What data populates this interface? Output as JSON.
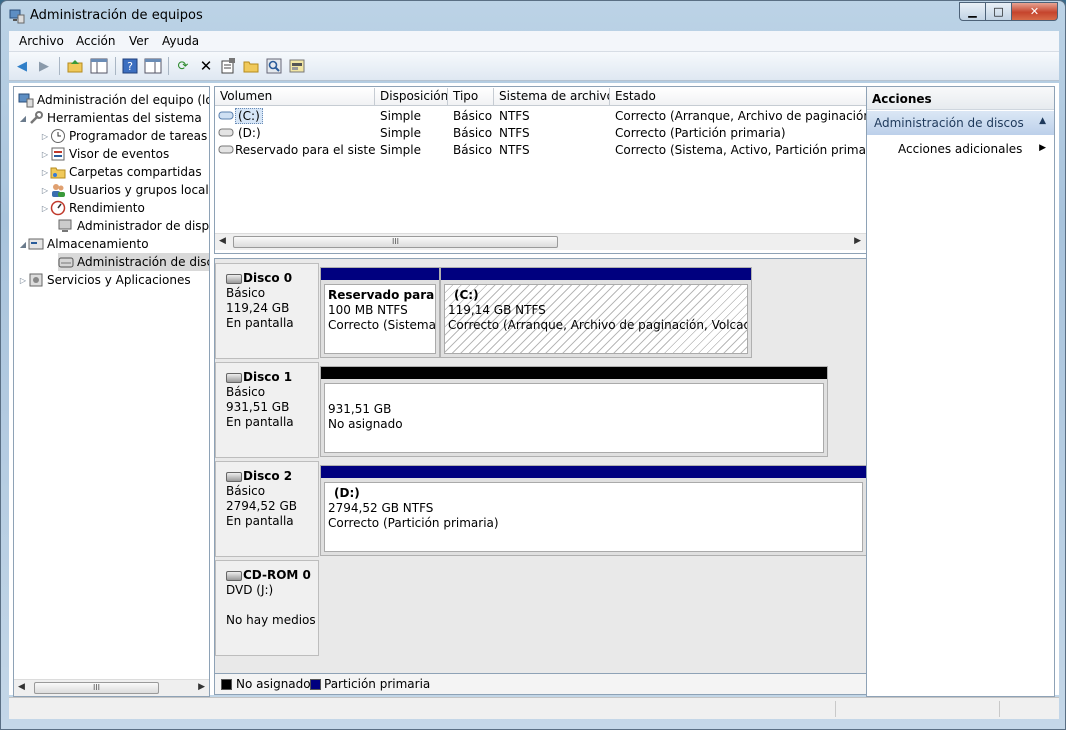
{
  "window": {
    "title": "Administración de equipos",
    "buttons": {
      "minimize": "▁",
      "maximize": "□",
      "close": "✕"
    }
  },
  "menu": [
    "Archivo",
    "Acción",
    "Ver",
    "Ayuda"
  ],
  "tree": {
    "items": [
      {
        "label": "Administración del equipo (loc",
        "icon": "computer-management-icon"
      },
      {
        "label": "Herramientas del sistema",
        "icon": "tools-icon"
      },
      {
        "label": "Programador de tareas",
        "icon": "clock-icon"
      },
      {
        "label": "Visor de eventos",
        "icon": "event-viewer-icon"
      },
      {
        "label": "Carpetas compartidas",
        "icon": "shared-folder-icon"
      },
      {
        "label": "Usuarios y grupos locale",
        "icon": "users-icon"
      },
      {
        "label": "Rendimiento",
        "icon": "performance-icon"
      },
      {
        "label": "Administrador de dispo",
        "icon": "device-manager-icon"
      },
      {
        "label": "Almacenamiento",
        "icon": "storage-icon"
      },
      {
        "label": "Administración de disco",
        "icon": "disk-management-icon"
      },
      {
        "label": "Servicios y Aplicaciones",
        "icon": "services-icon"
      }
    ],
    "scroll_thumb": "III"
  },
  "volumes": {
    "headers": [
      "Volumen",
      "Disposición",
      "Tipo",
      "Sistema de archivos",
      "Estado"
    ],
    "rows": [
      {
        "name": "(C:)",
        "layout": "Simple",
        "type": "Básico",
        "fs": "NTFS",
        "status": "Correcto (Arranque, Archivo de paginación, Vol"
      },
      {
        "name": "(D:)",
        "layout": "Simple",
        "type": "Básico",
        "fs": "NTFS",
        "status": "Correcto (Partición primaria)"
      },
      {
        "name": "Reservado para el sistema",
        "layout": "Simple",
        "type": "Básico",
        "fs": "NTFS",
        "status": "Correcto (Sistema, Activo, Partición primaria)"
      }
    ],
    "scroll_thumb": "III"
  },
  "disks": [
    {
      "name": "Disco 0",
      "kind": "Básico",
      "size": "119,24 GB",
      "state": "En pantalla",
      "parts": [
        {
          "title": "Reservado para el s",
          "size": "100 MB NTFS",
          "status": "Correcto (Sistema, A"
        },
        {
          "title": "(C:)",
          "size": "119,14 GB NTFS",
          "status": "Correcto (Arranque, Archivo de paginación, Volcado, Pa"
        }
      ]
    },
    {
      "name": "Disco 1",
      "kind": "Básico",
      "size": "931,51 GB",
      "state": "En pantalla",
      "parts": [
        {
          "size": "931,51 GB",
          "status": "No asignado"
        }
      ]
    },
    {
      "name": "Disco 2",
      "kind": "Básico",
      "size": "2794,52 GB",
      "state": "En pantalla",
      "parts": [
        {
          "title": "(D:)",
          "size": "2794,52 GB NTFS",
          "status": "Correcto (Partición primaria)"
        }
      ]
    },
    {
      "name": "CD-ROM 0",
      "kind": "DVD (J:)",
      "state": "No hay medios"
    }
  ],
  "legend": {
    "unallocated": "No asignado",
    "primary": "Partición primaria"
  },
  "actions": {
    "header": "Acciones",
    "section": "Administración de discos",
    "item": "Acciones adicionales"
  },
  "colors": {
    "primary_partition": "#00007f",
    "unallocated": "#000000",
    "selection": "#d7e6f7"
  }
}
